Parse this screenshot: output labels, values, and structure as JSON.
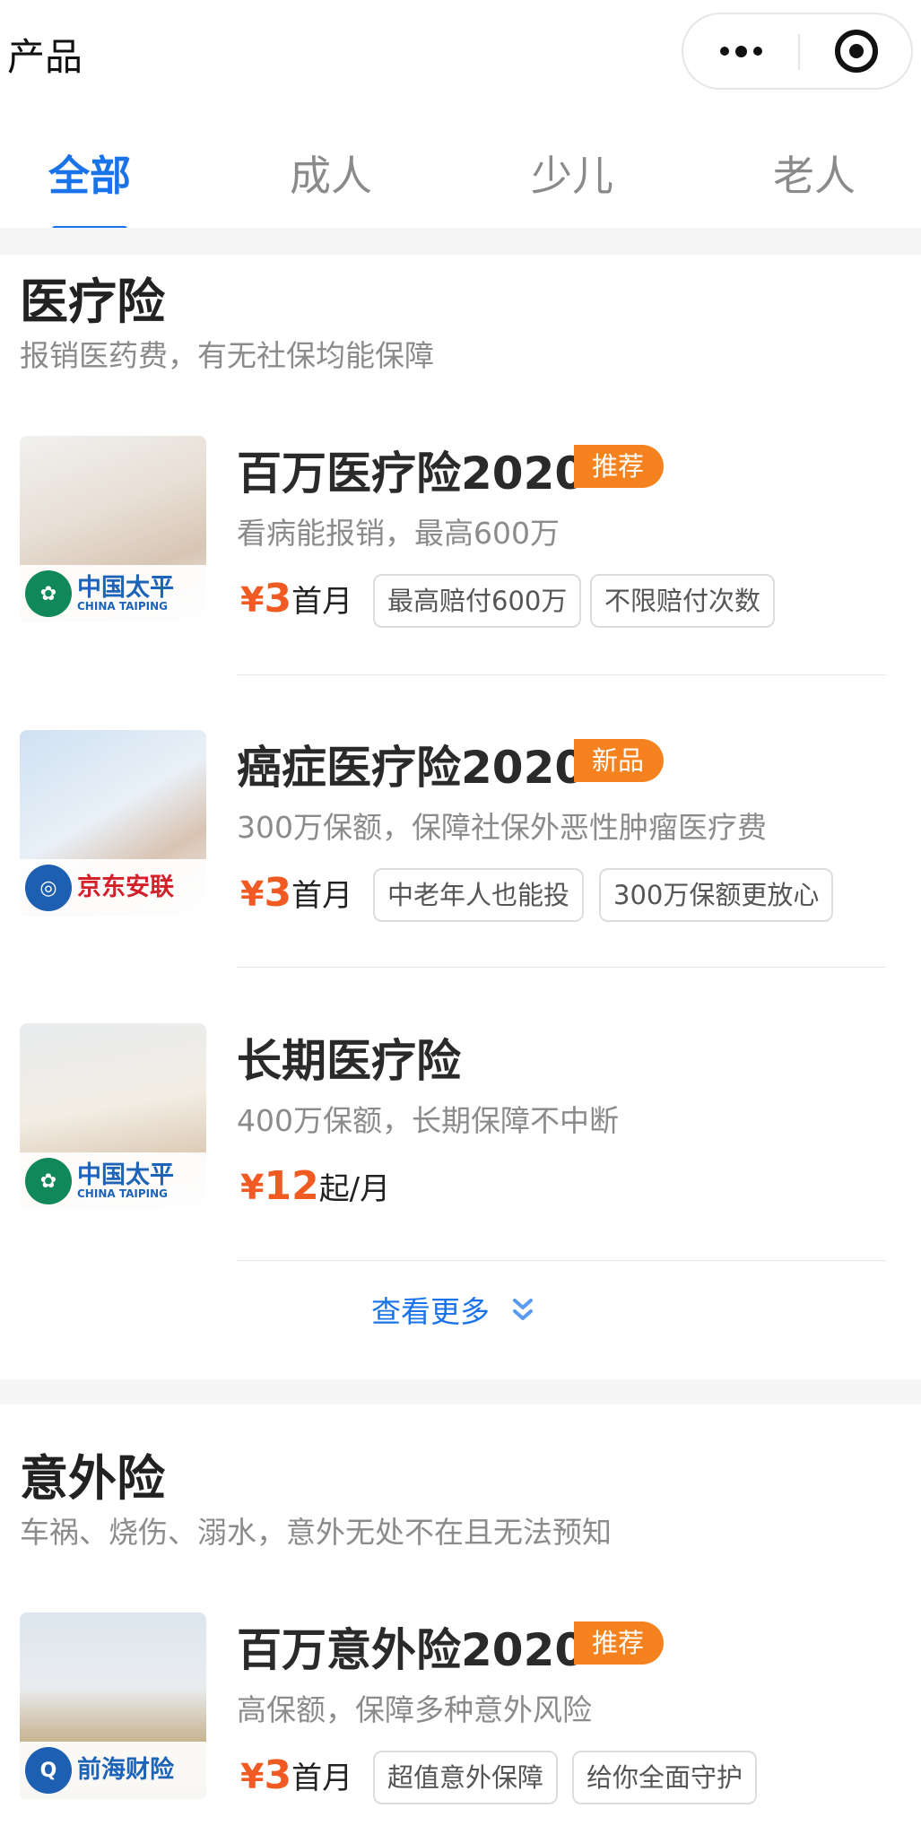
{
  "header": {
    "title": "产品"
  },
  "tabs": [
    {
      "label": "全部",
      "active": true
    },
    {
      "label": "成人",
      "active": false
    },
    {
      "label": "少儿",
      "active": false
    },
    {
      "label": "老人",
      "active": false
    }
  ],
  "sections": [
    {
      "title": "医疗险",
      "subtitle": "报销医药费，有无社保均能保障",
      "products": [
        {
          "name": "百万医疗险2020",
          "badge": "推荐",
          "desc": "看病能报销，最高600万",
          "price_symbol": "¥",
          "price_value": "3",
          "price_unit": "首月",
          "tags": [
            "最高赔付600万",
            "不限赔付次数"
          ],
          "brand": {
            "cn": "中国太平",
            "en": "CHINA TAIPING"
          }
        },
        {
          "name": "癌症医疗险2020",
          "badge": "新品",
          "desc": "300万保额，保障社保外恶性肿瘤医疗费",
          "price_symbol": "¥",
          "price_value": "3",
          "price_unit": "首月",
          "tags": [
            "中老年人也能投",
            "300万保额更放心"
          ],
          "brand": {
            "cn": "京东安联",
            "en": ""
          }
        },
        {
          "name": "长期医疗险",
          "badge": "",
          "desc": "400万保额，长期保障不中断",
          "price_symbol": "¥",
          "price_value": "12",
          "price_unit": "起/月",
          "tags": [],
          "brand": {
            "cn": "中国太平",
            "en": "CHINA TAIPING"
          }
        }
      ],
      "view_more": "查看更多"
    },
    {
      "title": "意外险",
      "subtitle": "车祸、烧伤、溺水，意外无处不在且无法预知",
      "products": [
        {
          "name": "百万意外险2020",
          "badge": "推荐",
          "desc": "高保额，保障多种意外风险",
          "price_symbol": "¥",
          "price_value": "3",
          "price_unit": "首月",
          "tags": [
            "超值意外保障",
            "给你全面守护"
          ],
          "brand": {
            "cn": "前海财险",
            "en": ""
          }
        }
      ]
    }
  ],
  "colors": {
    "accent": "#1a73e8",
    "price": "#f15a22",
    "badge": "#f5821f"
  },
  "icons": [
    "more-dots-icon",
    "close-target-icon",
    "double-chevron-down-icon"
  ]
}
